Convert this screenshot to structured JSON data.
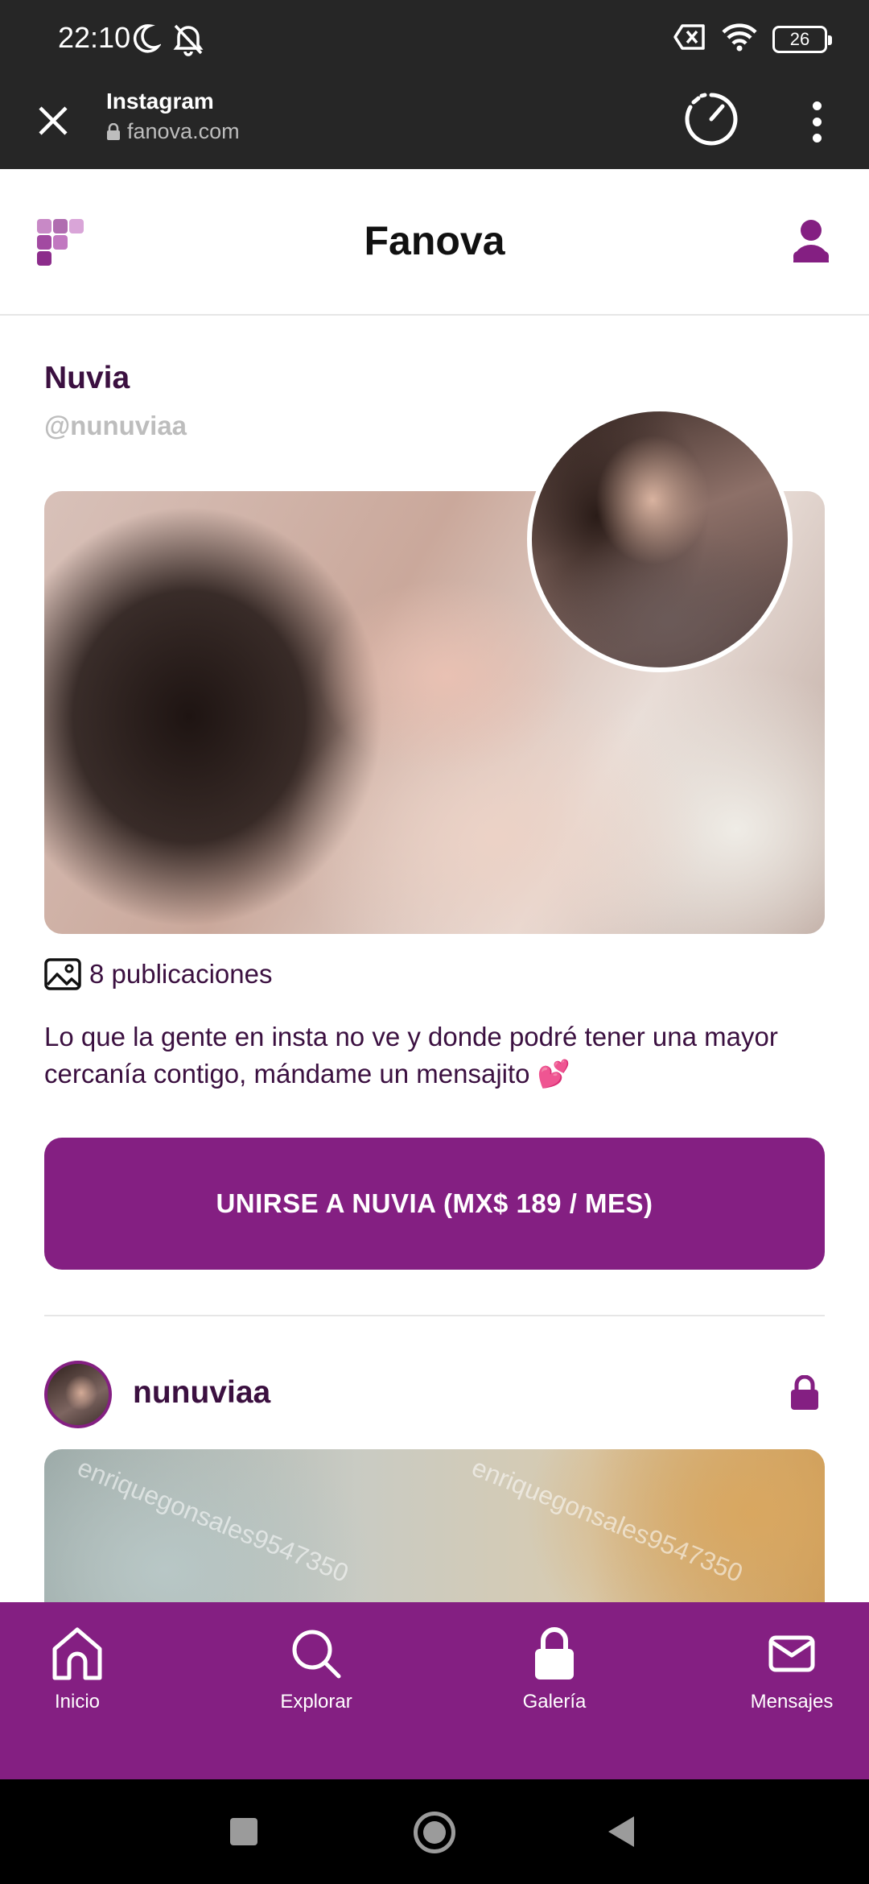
{
  "status_bar": {
    "time": "22:10",
    "battery": "26"
  },
  "browser": {
    "title": "Instagram",
    "url": "fanova.com"
  },
  "app": {
    "brand": "Fanova",
    "accent_color": "#841f82"
  },
  "profile": {
    "name": "Nuvia",
    "handle": "@nunuviaa",
    "posts_count": "8 publicaciones",
    "bio": "Lo que la gente en insta no ve y donde podré tener una mayor cercanía contigo, mándame un mensajito 💕",
    "join_button": "UNIRSE A NUVIA (MX$ 189 / MES)"
  },
  "post": {
    "username": "nunuviaa",
    "watermark": "enriquegonsales9547350"
  },
  "bottom_nav": {
    "items": [
      {
        "label": "Inicio",
        "icon": "home-icon"
      },
      {
        "label": "Explorar",
        "icon": "search-icon"
      },
      {
        "label": "Galería",
        "icon": "lock-icon"
      },
      {
        "label": "Mensajes",
        "icon": "mail-icon"
      }
    ]
  }
}
